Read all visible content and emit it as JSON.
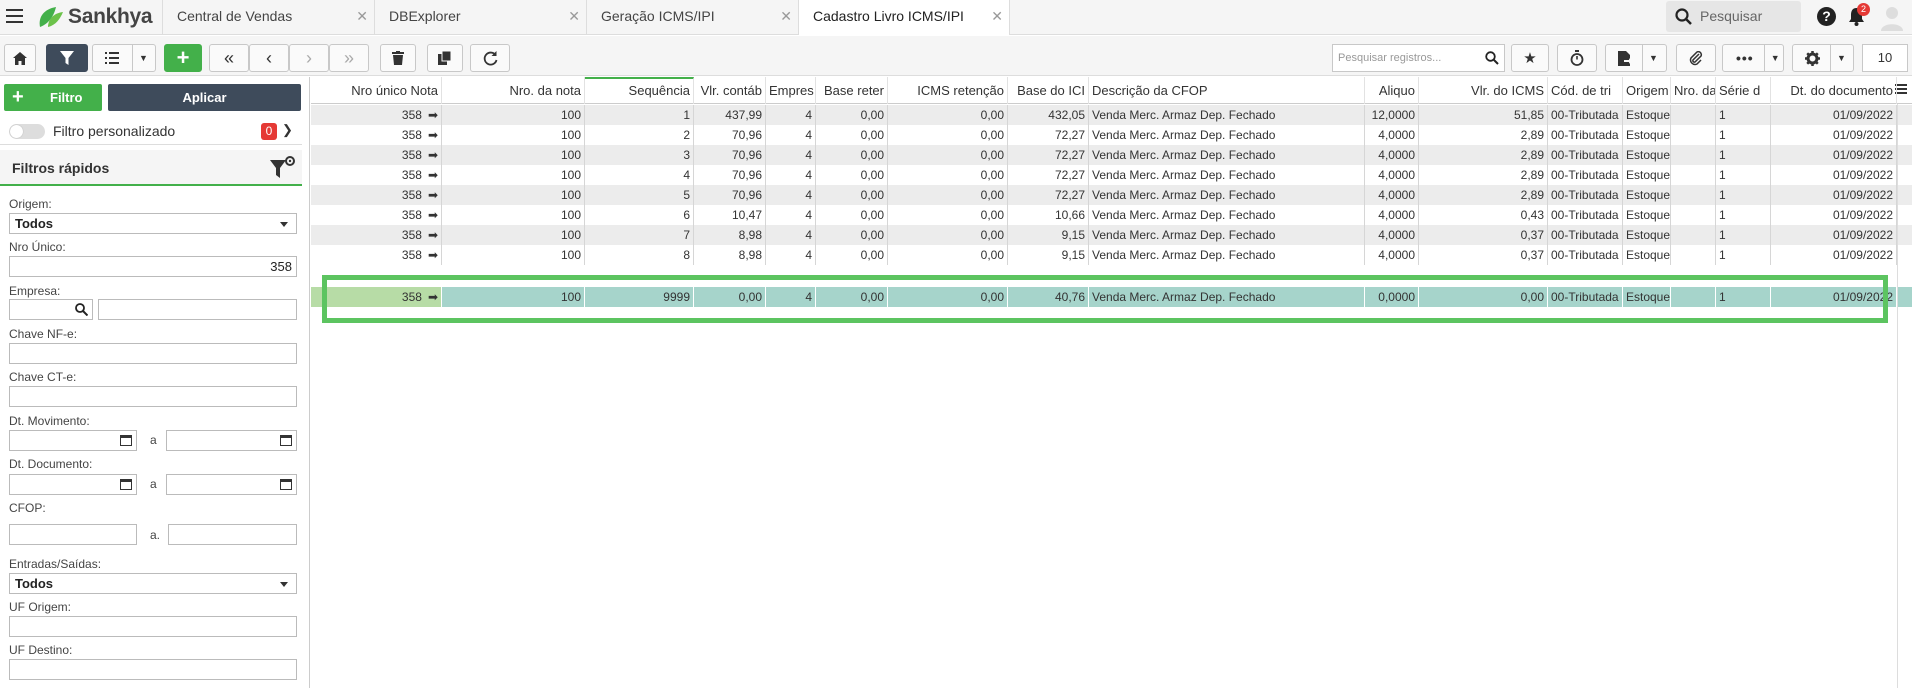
{
  "app": {
    "brand": "Sankhya"
  },
  "tabs": [
    {
      "label": "Central de Vendas"
    },
    {
      "label": "DBExplorer"
    },
    {
      "label": "Geração ICMS/IPI"
    },
    {
      "label": "Cadastro Livro ICMS/IPI"
    }
  ],
  "topbar": {
    "search_placeholder": "Pesquisar",
    "notification_count": "2"
  },
  "toolbar": {
    "record_search_placeholder": "Pesquisar registros...",
    "page_size": "10"
  },
  "sidebar": {
    "filter_button": "Filtro",
    "apply_button": "Aplicar",
    "custom_filter_label": "Filtro personalizado",
    "custom_filter_count": "0",
    "quick_filters_title": "Filtros rápidos",
    "fields": {
      "origem_label": "Origem:",
      "origem_value": "Todos",
      "nro_unico_label": "Nro Único:",
      "nro_unico_value": "358",
      "empresa_label": "Empresa:",
      "chave_nfe_label": "Chave NF-e:",
      "chave_cte_label": "Chave CT-e:",
      "dt_movimento_label": "Dt. Movimento:",
      "dt_documento_label": "Dt. Documento:",
      "cfop_label": "CFOP:",
      "entradas_label": "Entradas/Saídas:",
      "entradas_value": "Todos",
      "uf_origem_label": "UF Origem:",
      "uf_destino_label": "UF Destino:",
      "range_sep": "a",
      "range_sep_dot": "a."
    }
  },
  "grid": {
    "columns": [
      "Nro único Nota",
      "Nro. da nota",
      "Sequência",
      "Vlr. contáb",
      "Empres",
      "Base reter",
      "ICMS retenção",
      "Base do ICI",
      "Descrição da CFOP",
      "Aliquo",
      "Vlr. do ICMS",
      "Cód. de tri",
      "Origem",
      "Nro. da",
      "Série d",
      "Dt. do documento"
    ],
    "rows": [
      [
        "358",
        "100",
        "1",
        "437,99",
        "4",
        "0,00",
        "0,00",
        "432,05",
        "Venda Merc. Armaz Dep. Fechado",
        "12,0000",
        "51,85",
        "00-Tributada",
        "Estoque",
        "",
        "1",
        "01/09/2022"
      ],
      [
        "358",
        "100",
        "2",
        "70,96",
        "4",
        "0,00",
        "0,00",
        "72,27",
        "Venda Merc. Armaz Dep. Fechado",
        "4,0000",
        "2,89",
        "00-Tributada",
        "Estoque",
        "",
        "1",
        "01/09/2022"
      ],
      [
        "358",
        "100",
        "3",
        "70,96",
        "4",
        "0,00",
        "0,00",
        "72,27",
        "Venda Merc. Armaz Dep. Fechado",
        "4,0000",
        "2,89",
        "00-Tributada",
        "Estoque",
        "",
        "1",
        "01/09/2022"
      ],
      [
        "358",
        "100",
        "4",
        "70,96",
        "4",
        "0,00",
        "0,00",
        "72,27",
        "Venda Merc. Armaz Dep. Fechado",
        "4,0000",
        "2,89",
        "00-Tributada",
        "Estoque",
        "",
        "1",
        "01/09/2022"
      ],
      [
        "358",
        "100",
        "5",
        "70,96",
        "4",
        "0,00",
        "0,00",
        "72,27",
        "Venda Merc. Armaz Dep. Fechado",
        "4,0000",
        "2,89",
        "00-Tributada",
        "Estoque",
        "",
        "1",
        "01/09/2022"
      ],
      [
        "358",
        "100",
        "6",
        "10,47",
        "4",
        "0,00",
        "0,00",
        "10,66",
        "Venda Merc. Armaz Dep. Fechado",
        "4,0000",
        "0,43",
        "00-Tributada",
        "Estoque",
        "",
        "1",
        "01/09/2022"
      ],
      [
        "358",
        "100",
        "7",
        "8,98",
        "4",
        "0,00",
        "0,00",
        "9,15",
        "Venda Merc. Armaz Dep. Fechado",
        "4,0000",
        "0,37",
        "00-Tributada",
        "Estoque",
        "",
        "1",
        "01/09/2022"
      ],
      [
        "358",
        "100",
        "8",
        "8,98",
        "4",
        "0,00",
        "0,00",
        "9,15",
        "Venda Merc. Armaz Dep. Fechado",
        "4,0000",
        "0,37",
        "00-Tributada",
        "Estoque",
        "",
        "1",
        "01/09/2022"
      ]
    ],
    "selected_row": [
      "358",
      "100",
      "9999",
      "0,00",
      "4",
      "0,00",
      "0,00",
      "40,76",
      "Venda Merc. Armaz Dep. Fechado",
      "0,0000",
      "0,00",
      "00-Tributada",
      "Estoque",
      "",
      "1",
      "01/09/2022"
    ]
  }
}
